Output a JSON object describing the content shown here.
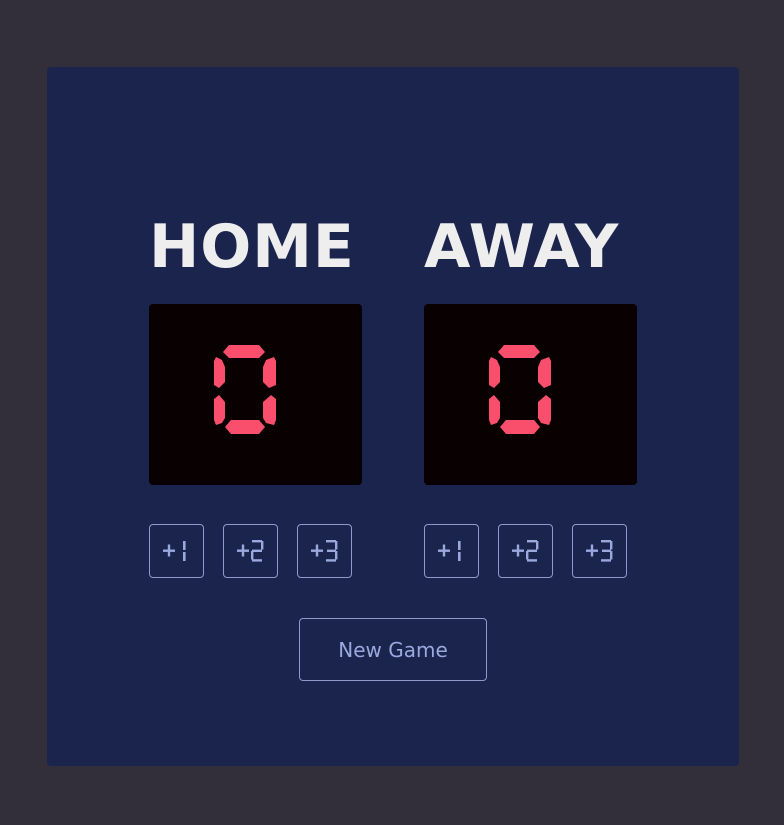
{
  "colors": {
    "page_background": "#322f3a",
    "panel_background": "#1b244c",
    "display_background": "#080001",
    "digit_color": "#f94f6d",
    "title_color": "#eeeeee",
    "button_border": "#8f9ac9",
    "button_text": "#9aa8de"
  },
  "home": {
    "title": "HOME",
    "score": "0",
    "buttons": [
      {
        "label": "+1"
      },
      {
        "label": "+2"
      },
      {
        "label": "+3"
      }
    ]
  },
  "away": {
    "title": "AWAY",
    "score": "0",
    "buttons": [
      {
        "label": "+1"
      },
      {
        "label": "+2"
      },
      {
        "label": "+3"
      }
    ]
  },
  "new_game_label": "New Game"
}
